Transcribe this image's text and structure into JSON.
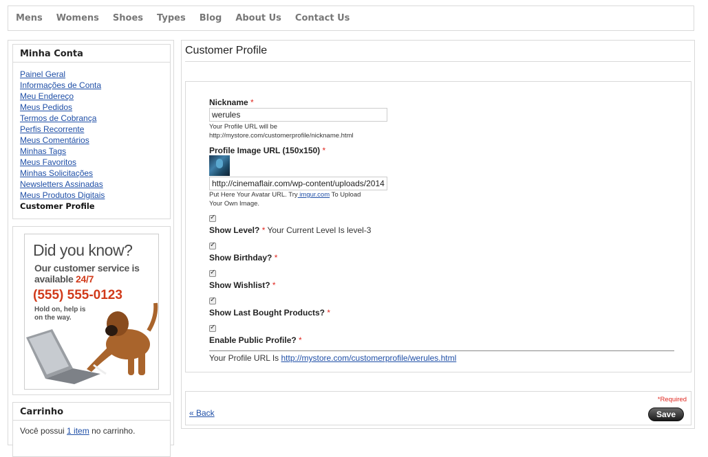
{
  "nav": {
    "items": [
      "Mens",
      "Womens",
      "Shoes",
      "Types",
      "Blog",
      "About Us",
      "Contact Us"
    ]
  },
  "sidebar": {
    "account_title": "Minha Conta",
    "links": [
      "Painel Geral",
      "Informações de Conta",
      "Meu Endereço",
      "Meus Pedidos",
      "Termos de Cobrança",
      "Perfis Recorrente",
      "Meus Comentários",
      "Minhas Tags",
      "Meus Favoritos",
      "Minhas Solicitações",
      "Newsletters Assinadas",
      "Meus Produtos Digitais"
    ],
    "current": "Customer Profile",
    "promo": {
      "headline": "Did you know?",
      "line1": "Our customer service is",
      "line2_prefix": "available ",
      "line2_highlight": "24/7",
      "phone": "(555) 555-0123",
      "hold1": "Hold on, help is",
      "hold2": "on the way."
    },
    "cart": {
      "title": "Carrinho",
      "text_prefix": "Você possui ",
      "item_link": "1 item",
      "text_suffix": " no carrinho."
    }
  },
  "main": {
    "title": "Customer Profile",
    "nickname": {
      "label": "Nickname",
      "required": "*",
      "value": "werules",
      "hint1": "Your Profile URL will be",
      "hint2": "http://mystore.com/customerprofile/nickname.html"
    },
    "image": {
      "label": "Profile Image URL (150x150)",
      "required": "*",
      "value": "http://cinemaflair.com/wp-content/uploads/2014",
      "hint_prefix": "Put Here Your Avatar URL. Try",
      "hint_link": " imgur.com",
      "hint_suffix": " To Upload",
      "hint2": "Your Own Image."
    },
    "options": [
      {
        "label": "Show Level?",
        "required": "*",
        "note": " Your Current Level Is level-3",
        "checked": true
      },
      {
        "label": "Show Birthday?",
        "required": "*",
        "note": "",
        "checked": true
      },
      {
        "label": "Show Wishlist?",
        "required": "*",
        "note": "",
        "checked": true
      },
      {
        "label": "Show Last Bought Products?",
        "required": "*",
        "note": "",
        "checked": true
      },
      {
        "label": "Enable Public Profile?",
        "required": "*",
        "note": "",
        "checked": true
      }
    ],
    "profile_url_prefix": "Your Profile URL Is ",
    "profile_url": "http://mystore.com/customerprofile/werules.html",
    "required_note": "*Required",
    "back": "« Back",
    "save": "Save"
  }
}
